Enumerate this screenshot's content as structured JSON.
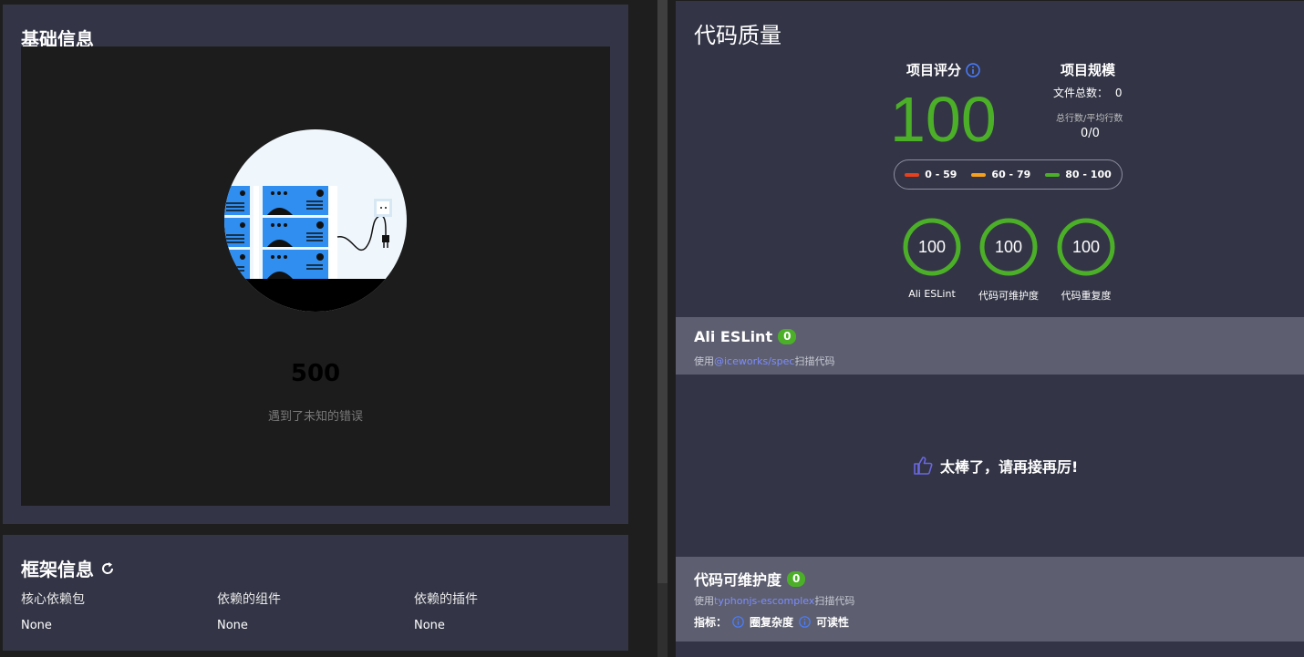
{
  "basic": {
    "title": "基础信息",
    "error_code": "500",
    "error_desc": "遇到了未知的错误"
  },
  "framework": {
    "title": "框架信息",
    "columns": [
      {
        "label": "核心依赖包",
        "value": "None"
      },
      {
        "label": "依赖的组件",
        "value": "None"
      },
      {
        "label": "依赖的插件",
        "value": "None"
      }
    ]
  },
  "quality": {
    "title": "代码质量",
    "score_label": "项目评分",
    "score": "100",
    "scale_title": "项目规模",
    "file_count_label": "文件总数：",
    "file_count": "0",
    "lines_label": "总行数/平均行数",
    "lines_value": "0/0",
    "legend": [
      {
        "label": "0 - 59",
        "color": "#e8401c"
      },
      {
        "label": "60 - 79",
        "color": "#f5a11b"
      },
      {
        "label": "80 - 100",
        "color": "#4caf28"
      }
    ],
    "rings": [
      {
        "value": "100",
        "label": "Ali ESLint"
      },
      {
        "value": "100",
        "label": "代码可维护度"
      },
      {
        "value": "100",
        "label": "代码重复度"
      }
    ],
    "eslint": {
      "title": "Ali ESLint",
      "badge": "0",
      "desc_prefix": "使用",
      "desc_link": "@iceworks/spec",
      "desc_suffix": "扫描代码"
    },
    "great_message": "太棒了，请再接再厉!",
    "maintainability": {
      "title": "代码可维护度",
      "badge": "0",
      "desc_prefix": "使用",
      "desc_link": "typhonjs-escomplex",
      "desc_suffix": "扫描代码",
      "metrics_label": "指标：",
      "metric1": "圈复杂度",
      "metric2": "可读性"
    }
  },
  "colors": {
    "accent_green": "#4caf28",
    "info_blue": "#4a7dff",
    "panel": "#333546"
  }
}
